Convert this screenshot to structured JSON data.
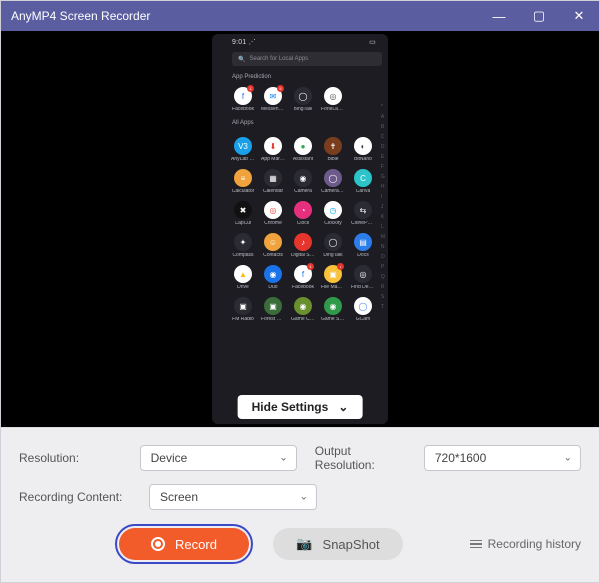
{
  "title": "AnyMP4 Screen Recorder",
  "phone": {
    "time": "9:01",
    "search_placeholder": "Search for Local Apps",
    "section_prediction": "App Prediction",
    "section_all": "All Apps",
    "prediction": [
      {
        "label": "Facebook",
        "glyph": "f",
        "bg": "#ffffff",
        "color": "#1877f2",
        "badge": "1"
      },
      {
        "label": "Messenger",
        "glyph": "✉",
        "bg": "#ffffff",
        "color": "#0a7cff",
        "badge": "5"
      },
      {
        "label": "BingTalk",
        "glyph": "◯",
        "bg": "#2b2b34"
      },
      {
        "label": "FoneLab Mirror",
        "glyph": "◎",
        "bg": "#ffffff",
        "color": "#555"
      }
    ],
    "grid": [
      [
        {
          "label": "AnyLab V3 Mobile Pro",
          "glyph": "V3",
          "bg": "#1aa0e8"
        },
        {
          "label": "App Market",
          "glyph": "⬇",
          "bg": "#ffffff",
          "color": "#e5352c"
        },
        {
          "label": "Assistant",
          "glyph": "●",
          "bg": "#ffffff",
          "color": "#34a853"
        },
        {
          "label": "Bible",
          "glyph": "✝",
          "bg": "#7a3e1f"
        },
        {
          "label": "BitNano",
          "glyph": "◐",
          "bg": "#ffffff",
          "color": "#444"
        }
      ],
      [
        {
          "label": "Calculator",
          "glyph": "≡",
          "bg": "#f0a23c"
        },
        {
          "label": "Calendar",
          "glyph": "▦",
          "bg": "#2b2b34"
        },
        {
          "label": "Camera",
          "glyph": "◉",
          "bg": "#2b2b34"
        },
        {
          "label": "Camera360",
          "glyph": "◯",
          "bg": "#6c5b8a"
        },
        {
          "label": "Canva",
          "glyph": "C",
          "bg": "#2cc3c9"
        }
      ],
      [
        {
          "label": "CapCut",
          "glyph": "✖",
          "bg": "#111"
        },
        {
          "label": "Chrome",
          "glyph": "◎",
          "bg": "#ffffff",
          "color": "#ea4335"
        },
        {
          "label": "Clock",
          "glyph": "◔",
          "bg": "#e6307e"
        },
        {
          "label": "Clockify",
          "glyph": "◷",
          "bg": "#ffffff",
          "color": "#03a9f4"
        },
        {
          "label": "ClonePhone",
          "glyph": "⇆",
          "bg": "#2b2b34"
        }
      ],
      [
        {
          "label": "Compass",
          "glyph": "✦",
          "bg": "#2b2b34"
        },
        {
          "label": "Contacts",
          "glyph": "☺",
          "bg": "#f0a23c"
        },
        {
          "label": "Digital Songbook",
          "glyph": "♪",
          "bg": "#e5352c"
        },
        {
          "label": "DingTalk",
          "glyph": "◯",
          "bg": "#2b2b34"
        },
        {
          "label": "Docs",
          "glyph": "▤",
          "bg": "#2c7de9"
        }
      ],
      [
        {
          "label": "Drive",
          "glyph": "▲",
          "bg": "#ffffff",
          "color": "#fbbc04"
        },
        {
          "label": "Duo",
          "glyph": "◉",
          "bg": "#1a73e8"
        },
        {
          "label": "Facebook",
          "glyph": "f",
          "bg": "#ffffff",
          "color": "#1877f2",
          "badge": "1"
        },
        {
          "label": "File Manager",
          "glyph": "▣",
          "bg": "#f8c23a",
          "badge": "•"
        },
        {
          "label": "Find Device",
          "glyph": "◎",
          "bg": "#2b2b34"
        }
      ],
      [
        {
          "label": "FM Radio",
          "glyph": "▣",
          "bg": "#2b2b34"
        },
        {
          "label": "Forest M…",
          "glyph": "▣",
          "bg": "#3a6d3a"
        },
        {
          "label": "Game Center",
          "glyph": "◉",
          "bg": "#6a8f2f"
        },
        {
          "label": "Game Space",
          "glyph": "◉",
          "bg": "#2e9a4a"
        },
        {
          "label": "GCam",
          "glyph": "◯",
          "bg": "#ffffff",
          "color": "#4285f4"
        }
      ]
    ],
    "alpha_index": [
      "*",
      "A",
      "B",
      "C",
      "D",
      "E",
      "F",
      "G",
      "H",
      "I",
      "J",
      "K",
      "L",
      "M",
      "N",
      "O",
      "P",
      "Q",
      "R",
      "S",
      "T"
    ]
  },
  "hide_settings_label": "Hide Settings",
  "settings": {
    "resolution_label": "Resolution:",
    "resolution_value": "Device",
    "output_label": "Output Resolution:",
    "output_value": "720*1600",
    "content_label": "Recording Content:",
    "content_value": "Screen"
  },
  "actions": {
    "record": "Record",
    "snapshot": "SnapShot",
    "history": "Recording history"
  }
}
